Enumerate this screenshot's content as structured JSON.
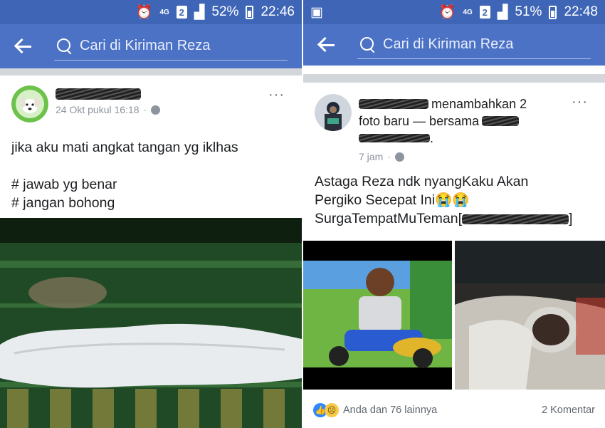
{
  "left": {
    "status": {
      "net": "4G",
      "sim": "2",
      "battery": "52%",
      "time": "22:46"
    },
    "search": {
      "placeholder": "Cari di Kiriman Reza"
    },
    "post": {
      "time": "24 Okt pukul 16:18",
      "more": "···",
      "text_line1": "jika aku mati angkat tangan yg iklhas",
      "text_line2": "# jawab yg benar",
      "text_line3": "# jangan bohong"
    }
  },
  "right": {
    "status": {
      "net": "4G",
      "sim": "2",
      "battery": "51%",
      "time": "22:48"
    },
    "search": {
      "placeholder": "Cari di Kiriman Reza"
    },
    "post": {
      "header_text1": "menambahkan 2",
      "header_text2": "foto baru — bersama",
      "time": "7 jam",
      "more": "···",
      "text_line1": "Astaga Reza ndk nyangKaku Akan",
      "text_line2": "Pergiko Secepat Ini😭😭",
      "text_line3": "SurgaTempatMuTeman[",
      "text_line3_end": "]",
      "reactions": "Anda dan 76 lainnya",
      "comments": "2 Komentar"
    }
  },
  "icons": [
    "back-arrow-icon",
    "search-icon",
    "globe-icon",
    "more-options-icon",
    "like-icon",
    "sad-icon",
    "alarm-icon",
    "signal-icon",
    "battery-icon"
  ],
  "colors": {
    "status_bar": "#3f66b6",
    "app_bar": "#4c72c6",
    "like_blue": "#2d88ff"
  }
}
